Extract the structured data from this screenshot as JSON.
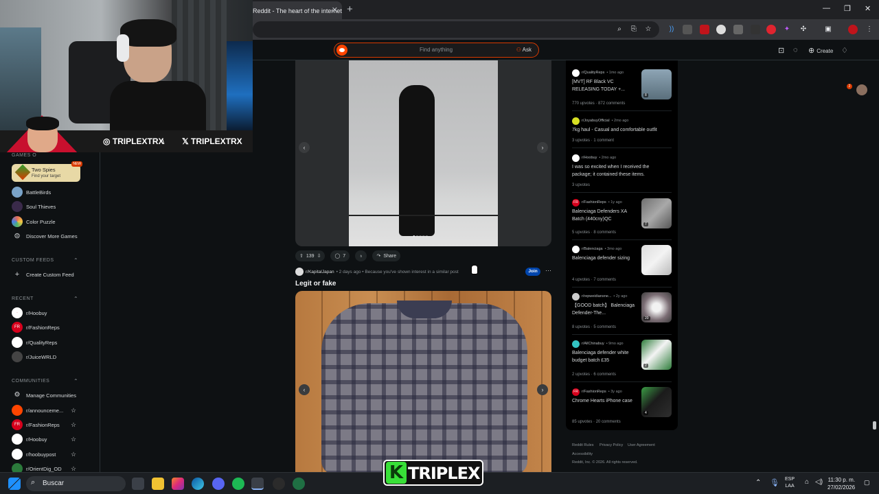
{
  "browser": {
    "tab_title": "Reddit - The heart of the internet",
    "tab_close": "✕",
    "new_tab": "+",
    "win_minimize": "—",
    "win_restore": "❐",
    "win_close": "✕"
  },
  "header": {
    "search_placeholder": "Find anything",
    "ask_label": "Ask",
    "create_label": "Create",
    "notif_count": "2"
  },
  "webcam": {
    "instagram_handle": "TRIPLEXTRX",
    "separator": "\\",
    "x_handle": "TRIPLEXTRX"
  },
  "sidebar": {
    "games_heading": "GAMES O",
    "featured_game": {
      "title": "Two Spies",
      "subtitle": "Find your target",
      "badge": "NEW"
    },
    "games": [
      {
        "label": "BattleBirds",
        "color": "#7aa3c8"
      },
      {
        "label": "Soul Thieves",
        "color": "#3a2a4a"
      },
      {
        "label": "Color Puzzle",
        "color": "#e36b5a"
      },
      {
        "label": "Discover More Games",
        "color": "#000000"
      }
    ],
    "custom_feeds_heading": "CUSTOM FEEDS",
    "create_custom_feed": "Create Custom Feed",
    "recent_heading": "RECENT",
    "recent": [
      {
        "label": "r/Hoobuy",
        "color": "#ffffff"
      },
      {
        "label": "r/FashionReps",
        "color": "#d6001c"
      },
      {
        "label": "r/QualityReps",
        "color": "#ffffff"
      },
      {
        "label": "r/JuiceWRLD",
        "color": "#444444"
      }
    ],
    "communities_heading": "COMMUNITIES",
    "manage_communities": "Manage Communities",
    "communities": [
      {
        "label": "r/announceme...",
        "color": "#ff4500"
      },
      {
        "label": "r/FashionReps",
        "color": "#d6001c"
      },
      {
        "label": "r/Hoobuy",
        "color": "#ffffff"
      },
      {
        "label": "r/hoobuypost",
        "color": "#ffffff"
      },
      {
        "label": "r/OrientDig_OD",
        "color": "#2b7a3b"
      }
    ]
  },
  "feed": {
    "post1": {
      "votes": "139",
      "comments": "7",
      "share": "Share"
    },
    "post2": {
      "subreddit": "r/KapitalJapan",
      "meta": "• 2 days ago • Because you've shown interest in a similar post",
      "join": "Join",
      "title": "Legit or fake"
    }
  },
  "right_sidebar": {
    "items": [
      {
        "sub": "r/QualityReps",
        "time": "• 1mo ago",
        "title": "[MVT] RF Black VC RELEASING TODAY +...",
        "upvotes": "770 upvotes",
        "comments": "872 comments",
        "thumb_count": "8",
        "av_color": "#ffffff"
      },
      {
        "sub": "r/JoyabuyOfficial",
        "time": "• 2mo ago",
        "title": "7kg haul - Casual and comfortable outfit",
        "upvotes": "3 upvotes",
        "comments": "1 comment",
        "av_color": "#d7df23"
      },
      {
        "sub": "r/Hoobuy",
        "time": "• 2mo ago",
        "title": "I was so excited when I received the package; it contained these items.",
        "upvotes": "3 upvotes",
        "comments": "",
        "av_color": "#ffffff"
      },
      {
        "sub": "r/FashionReps",
        "time": "• 1y ago",
        "title": "Balenciaga Defenders XA Batch (440cny)QC",
        "upvotes": "5 upvotes",
        "comments": "8 comments",
        "thumb_count": "7",
        "av_color": "#d6001c"
      },
      {
        "sub": "r/Balenciaga",
        "time": "• 3mo ago",
        "title": "Balenciaga defender sizing",
        "upvotes": "4 upvotes",
        "comments": "7 comments",
        "av_color": "#ffffff"
      },
      {
        "sub": "r/repweidiansne...",
        "time": "• 2y ago",
        "title": "【GOOD batch】 Balenciaga Defender-The...",
        "upvotes": "8 upvotes",
        "comments": "5 comments",
        "thumb_count": "20",
        "av_color": "#cccccc"
      },
      {
        "sub": "r/AllChinabuy",
        "time": "• 9mo ago",
        "title": "Balenciaga defender white budget batch £35",
        "upvotes": "2 upvotes",
        "comments": "6 comments",
        "thumb_count": "2",
        "av_color": "#33c3c3"
      },
      {
        "sub": "r/FashionReps",
        "time": "• 3y ago",
        "title": "Chrome Hearts iPhone case",
        "upvotes": "85 upvotes",
        "comments": "20 comments",
        "thumb_count": "4",
        "av_color": "#d6001c"
      }
    ],
    "footer": {
      "rules": "Reddit Rules",
      "privacy": "Privacy Policy",
      "agreement": "User Agreement",
      "accessibility": "Accessibility",
      "copyright": "Reddit, Inc. © 2026. All rights reserved."
    }
  },
  "taskbar": {
    "search": "Buscar",
    "lang1": "ESP",
    "lang2": "LAA",
    "time": "11:30 p. m.",
    "date": "27/02/2026"
  },
  "branding": {
    "k": "K",
    "word": "TRIPLEX"
  }
}
